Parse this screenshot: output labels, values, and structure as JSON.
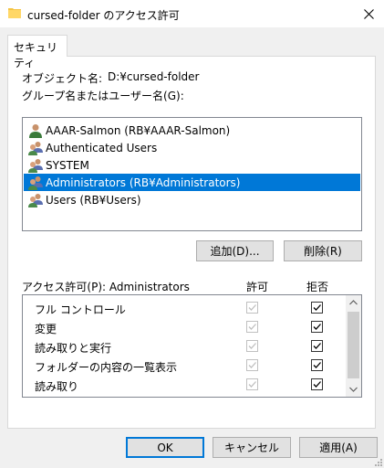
{
  "window": {
    "title": "cursed-folder のアクセス許可"
  },
  "tab": {
    "label": "セキュリティ"
  },
  "object": {
    "label": "オブジェクト名:",
    "value": "D:¥cursed-folder"
  },
  "principals": {
    "label": "グループ名またはユーザー名(G):",
    "items": [
      {
        "name": "AAAR-Salmon (RB¥AAAR-Salmon)",
        "icon": "user-icon",
        "selected": false
      },
      {
        "name": "Authenticated Users",
        "icon": "group-icon",
        "selected": false
      },
      {
        "name": "SYSTEM",
        "icon": "group-icon",
        "selected": false
      },
      {
        "name": "Administrators (RB¥Administrators)",
        "icon": "group-icon",
        "selected": true
      },
      {
        "name": "Users (RB¥Users)",
        "icon": "group-icon",
        "selected": false
      }
    ]
  },
  "buttons": {
    "add": "追加(D)...",
    "remove": "削除(R)",
    "ok": "OK",
    "cancel": "キャンセル",
    "apply": "適用(A)"
  },
  "permissions": {
    "label": "アクセス許可(P): Administrators",
    "allow_header": "許可",
    "deny_header": "拒否",
    "rows": [
      {
        "name": "フル コントロール",
        "allow": true,
        "allow_disabled": true,
        "deny": true
      },
      {
        "name": "変更",
        "allow": true,
        "allow_disabled": true,
        "deny": true
      },
      {
        "name": "読み取りと実行",
        "allow": true,
        "allow_disabled": true,
        "deny": true
      },
      {
        "name": "フォルダーの内容の一覧表示",
        "allow": true,
        "allow_disabled": true,
        "deny": true
      },
      {
        "name": "読み取り",
        "allow": true,
        "allow_disabled": true,
        "deny": true
      }
    ]
  },
  "colors": {
    "selection": "#0078d7",
    "folder": "#f5c443"
  }
}
